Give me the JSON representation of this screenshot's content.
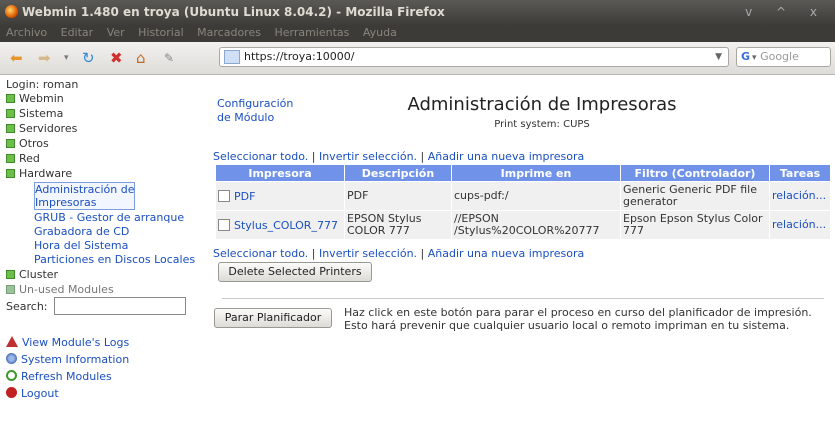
{
  "window": {
    "title": "Webmin 1.480 en troya (Ubuntu Linux 8.04.2) - Mozilla Firefox",
    "controls": "v ^ x"
  },
  "menubar": [
    "Archivo",
    "Editar",
    "Ver",
    "Historial",
    "Marcadores",
    "Herramientas",
    "Ayuda"
  ],
  "navbar": {
    "url": "https://troya:10000/",
    "search_placeholder": "Google"
  },
  "sidebar": {
    "login": "Login: roman",
    "categories": [
      {
        "label": "Webmin"
      },
      {
        "label": "Sistema"
      },
      {
        "label": "Servidores"
      },
      {
        "label": "Otros"
      },
      {
        "label": "Red"
      },
      {
        "label": "Hardware"
      }
    ],
    "hardware_items": [
      "Administración de",
      "Impresoras",
      "GRUB - Gestor de arranque",
      "Grabadora de CD",
      "Hora del Sistema",
      "Particiones en Discos Locales"
    ],
    "cluster": "Cluster",
    "unused": "Un-used Modules",
    "search_label": "Search:",
    "actions": {
      "logs": "View Module's Logs",
      "sysinfo": "System Information",
      "refresh": "Refresh Modules",
      "logout": "Logout"
    }
  },
  "main": {
    "module_config_line1": "Configuración",
    "module_config_line2": "de Módulo",
    "title": "Administración de Impresoras",
    "subtitle": "Print system: CUPS",
    "select_all": "Seleccionar todo.",
    "invert": "Invertir selección.",
    "add_printer": "Añadir una nueva impresora",
    "sep": "|",
    "table": {
      "headers": [
        "Impresora",
        "Descripción",
        "Imprime en",
        "Filtro (Controlador)",
        "Tareas"
      ],
      "rows": [
        {
          "name": "PDF",
          "desc": "PDF",
          "desc2": "",
          "dest": "cups-pdf:/",
          "dest2": "",
          "filter": "Generic Generic PDF file",
          "filter2": "generator",
          "tasks": "relación..."
        },
        {
          "name": "Stylus_COLOR_777",
          "desc": "EPSON Stylus",
          "desc2": "COLOR 777",
          "dest": "//EPSON",
          "dest2": "/Stylus%20COLOR%20777",
          "filter": "Epson Epson Stylus Color",
          "filter2": "777",
          "tasks": "relación..."
        }
      ]
    },
    "delete_button": "Delete Selected Printers",
    "stop_button": "Parar Planificador",
    "stop_desc": "Haz click en este botón para parar el proceso en curso del planificador de impresión. Esto hará prevenir que cualquier usuario local o remoto impriman en tu sistema."
  }
}
